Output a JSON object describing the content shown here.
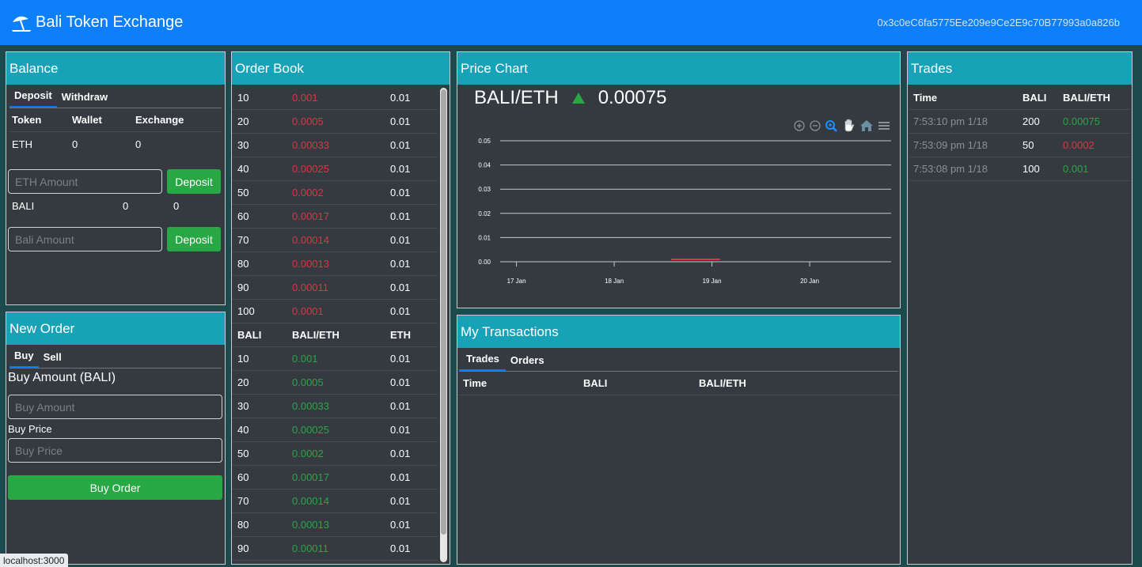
{
  "navbar": {
    "brand": "Bali Token Exchange",
    "account": "0x3c0eC6fa5775Ee209e9Ce2E9c70B77993a0a826b"
  },
  "balance": {
    "title": "Balance",
    "tabs": [
      "Deposit",
      "Withdraw"
    ],
    "headers": [
      "Token",
      "Wallet",
      "Exchange"
    ],
    "eth": {
      "token": "ETH",
      "wallet": "0",
      "exchange": "0",
      "placeholder": "ETH Amount",
      "button": "Deposit"
    },
    "bali": {
      "token": "BALI",
      "wallet": "0",
      "exchange": "0",
      "placeholder": "Bali Amount",
      "button": "Deposit"
    }
  },
  "new_order": {
    "title": "New Order",
    "tabs": [
      "Buy",
      "Sell"
    ],
    "amount_label": "Buy Amount (BALI)",
    "amount_placeholder": "Buy Amount",
    "price_label": "Buy Price",
    "price_placeholder": "Buy Price",
    "button": "Buy Order"
  },
  "order_book": {
    "title": "Order Book",
    "sells": [
      [
        "10",
        "0.001",
        "0.01"
      ],
      [
        "20",
        "0.0005",
        "0.01"
      ],
      [
        "30",
        "0.00033",
        "0.01"
      ],
      [
        "40",
        "0.00025",
        "0.01"
      ],
      [
        "50",
        "0.0002",
        "0.01"
      ],
      [
        "60",
        "0.00017",
        "0.01"
      ],
      [
        "70",
        "0.00014",
        "0.01"
      ],
      [
        "80",
        "0.00013",
        "0.01"
      ],
      [
        "90",
        "0.00011",
        "0.01"
      ],
      [
        "100",
        "0.0001",
        "0.01"
      ]
    ],
    "headers": [
      "BALI",
      "BALI/ETH",
      "ETH"
    ],
    "buys": [
      [
        "10",
        "0.001",
        "0.01"
      ],
      [
        "20",
        "0.0005",
        "0.01"
      ],
      [
        "30",
        "0.00033",
        "0.01"
      ],
      [
        "40",
        "0.00025",
        "0.01"
      ],
      [
        "50",
        "0.0002",
        "0.01"
      ],
      [
        "60",
        "0.00017",
        "0.01"
      ],
      [
        "70",
        "0.00014",
        "0.01"
      ],
      [
        "80",
        "0.00013",
        "0.01"
      ],
      [
        "90",
        "0.00011",
        "0.01"
      ]
    ]
  },
  "price_chart": {
    "title": "Price Chart",
    "pair": "BALI/ETH",
    "price": "0.00075",
    "trend_color": "#28a745",
    "toolbar_icons": [
      "zoom-in-icon",
      "zoom-out-icon",
      "selection-zoom-icon",
      "pan-hand-icon",
      "home-icon",
      "menu-icon"
    ]
  },
  "chart_data": {
    "type": "line",
    "title": "",
    "xlabel": "",
    "ylabel": "",
    "y_ticks": [
      "0.05",
      "0.04",
      "0.03",
      "0.02",
      "0.01",
      "0.00"
    ],
    "x_ticks": [
      "17 Jan",
      "18 Jan",
      "19 Jan",
      "20 Jan"
    ],
    "ylim": [
      0,
      0.05
    ],
    "xlim": [
      "2021-01-16 20:00",
      "2021-01-20 20:00"
    ],
    "grid": true,
    "series": [
      {
        "color": "#dc3545",
        "x": [
          "2021-01-18 14:00",
          "2021-01-19 02:00"
        ],
        "values": [
          0.001,
          0.001
        ]
      }
    ]
  },
  "my_transactions": {
    "title": "My Transactions",
    "tabs": [
      "Trades",
      "Orders"
    ],
    "headers": [
      "Time",
      "BALI",
      "BALI/ETH"
    ]
  },
  "trades": {
    "title": "Trades",
    "headers": [
      "Time",
      "BALI",
      "BALI/ETH"
    ],
    "rows": [
      {
        "time": "7:53:10 pm 1/18",
        "amount": "200",
        "price": "0.00075",
        "color": "green"
      },
      {
        "time": "7:53:09 pm 1/18",
        "amount": "50",
        "price": "0.0002",
        "color": "red"
      },
      {
        "time": "7:53:08 pm 1/18",
        "amount": "100",
        "price": "0.001",
        "color": "green"
      }
    ]
  },
  "status_url": "localhost:3000"
}
